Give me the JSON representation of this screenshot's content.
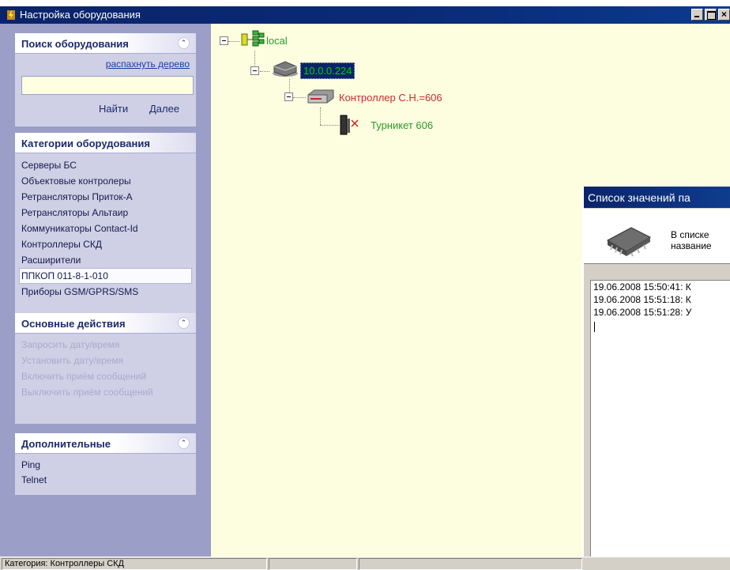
{
  "window": {
    "title": "Настройка оборудования",
    "buttons": [
      "minimize",
      "maximize",
      "close"
    ]
  },
  "search_panel": {
    "title": "Поиск оборудования",
    "expand_tree_link": "распахнуть дерево",
    "search_value": "",
    "find_label": "Найти",
    "next_label": "Далее"
  },
  "categories_panel": {
    "title": "Категории оборудования",
    "items": [
      "Серверы БС",
      "Объектовые контролеры",
      "Ретрансляторы Приток-А",
      "Ретрансляторы Альтаир",
      "Коммуникаторы Contact-Id",
      "Контроллеры СКД",
      "Расширители",
      "ППКОП 011-8-1-010",
      "Приборы GSM/GPRS/SMS"
    ],
    "selected_index": 7
  },
  "actions_panel": {
    "title": "Основные действия",
    "items": [
      "Запросить дату/время",
      "Установить дату/время",
      "Включить приём сообщений",
      "Выключить приём сообщений"
    ]
  },
  "extra_panel": {
    "title": "Дополнительные",
    "items": [
      "Ping",
      "Telnet"
    ]
  },
  "tree": {
    "root": {
      "label": "local",
      "icon": "network-tree-icon",
      "color": "#2a9a2a"
    },
    "server": {
      "label": "10.0.0.224",
      "icon": "server-device-icon",
      "color": "#00cc00",
      "selected_bg": "#0a246a"
    },
    "controller": {
      "label": "Контроллер С.Н.=606",
      "icon": "controller-icon",
      "color": "#cc2a2a"
    },
    "turnstile": {
      "label": "Турникет 606",
      "icon": "turnstile-icon",
      "color": "#2a9a2a"
    }
  },
  "dialog": {
    "title": "Список значений па",
    "message_line1": "В списке",
    "message_line2": "название",
    "log_lines": [
      "19.06.2008 15:50:41: К",
      "19.06.2008 15:51:18: К",
      "19.06.2008 15:51:28: У"
    ]
  },
  "status_bar": {
    "category": "Категория: Контроллеры СКД"
  }
}
